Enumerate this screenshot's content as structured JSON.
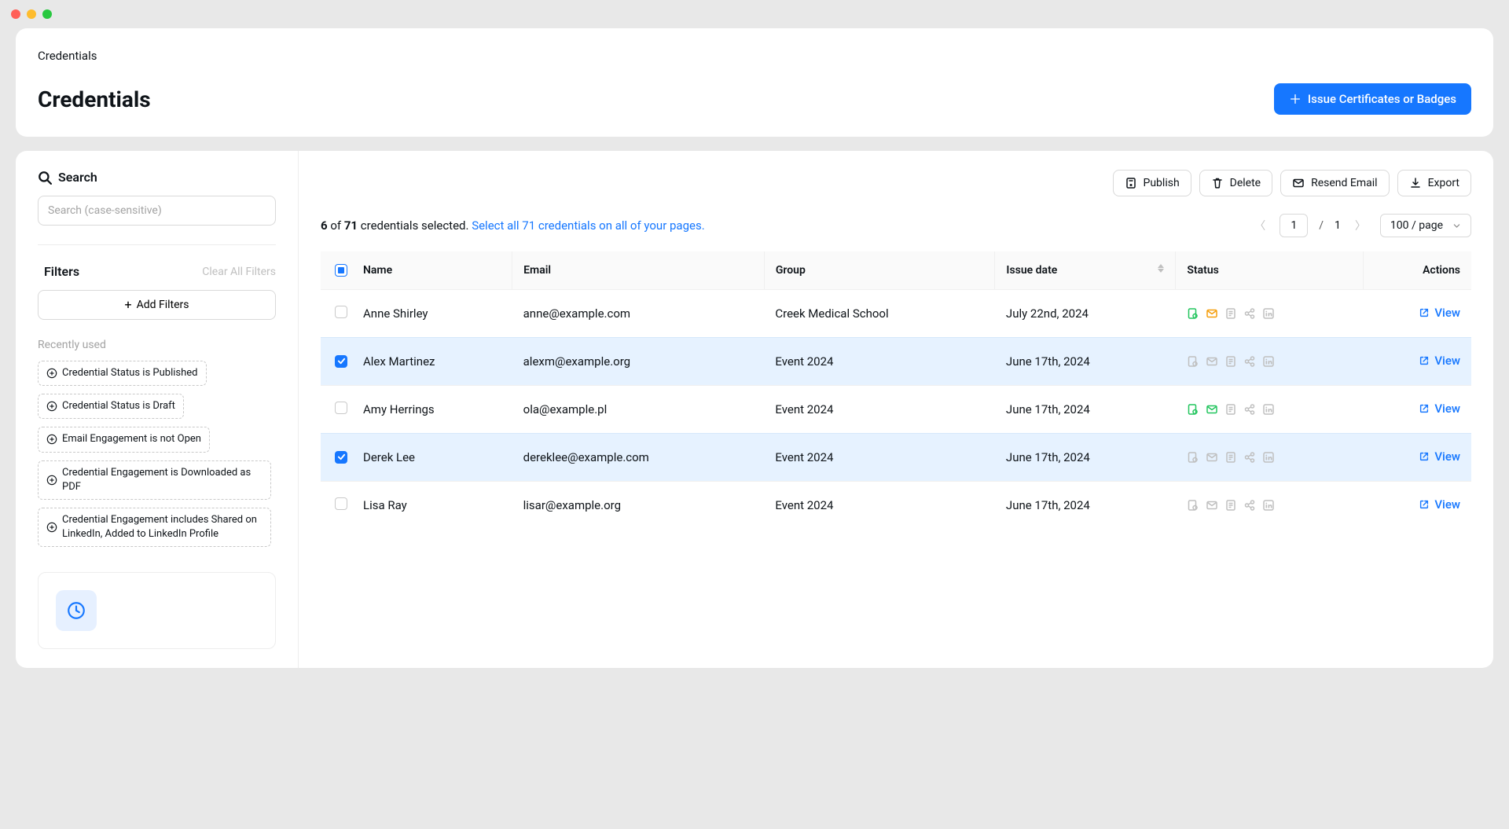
{
  "breadcrumb": "Credentials",
  "pageTitle": "Credentials",
  "issueButton": "Issue Certificates or Badges",
  "search": {
    "heading": "Search",
    "placeholder": "Search (case-sensitive)"
  },
  "filters": {
    "heading": "Filters",
    "clearAll": "Clear All Filters",
    "addFilters": "Add Filters",
    "recentlyUsed": "Recently used",
    "chips": [
      "Credential Status is Published",
      "Credential Status is Draft",
      "Email Engagement is not Open",
      "Credential Engagement is Downloaded as PDF",
      "Credential Engagement includes Shared on LinkedIn, Added to LinkedIn Profile"
    ]
  },
  "toolbar": {
    "publish": "Publish",
    "delete": "Delete",
    "resend": "Resend Email",
    "export": "Export"
  },
  "selection": {
    "countSelected": "6",
    "of": " of ",
    "total": "71",
    "suffix": " credentials selected. ",
    "selectAll": "Select all 71 credentials on all of your pages."
  },
  "pager": {
    "current": "1",
    "totalPages": "1",
    "perPage": "100 / page"
  },
  "columns": {
    "name": "Name",
    "email": "Email",
    "group": "Group",
    "issueDate": "Issue date",
    "status": "Status",
    "actions": "Actions"
  },
  "viewLabel": "View",
  "rows": [
    {
      "selected": false,
      "name": "Anne Shirley",
      "email": "anne@example.com",
      "group": "Creek Medical School",
      "issueDate": "July 22nd, 2024",
      "status": {
        "cert": "green",
        "mail": "orange",
        "doc": "gray",
        "share": "gray",
        "linkedin": "gray"
      }
    },
    {
      "selected": true,
      "name": "Alex Martinez",
      "email": "alexm@example.org",
      "group": "Event 2024",
      "issueDate": "June 17th, 2024",
      "status": {
        "cert": "gray",
        "mail": "gray",
        "doc": "gray",
        "share": "gray",
        "linkedin": "gray"
      }
    },
    {
      "selected": false,
      "name": "Amy Herrings",
      "email": "ola@example.pl",
      "group": "Event 2024",
      "issueDate": "June 17th, 2024",
      "status": {
        "cert": "green",
        "mail": "green",
        "doc": "gray",
        "share": "gray",
        "linkedin": "gray"
      }
    },
    {
      "selected": true,
      "name": "Derek Lee",
      "email": "dereklee@example.com",
      "group": "Event 2024",
      "issueDate": "June 17th, 2024",
      "status": {
        "cert": "gray",
        "mail": "gray",
        "doc": "gray",
        "share": "gray",
        "linkedin": "gray"
      }
    },
    {
      "selected": false,
      "name": "Lisa Ray",
      "email": "lisar@example.org",
      "group": "Event 2024",
      "issueDate": "June 17th, 2024",
      "status": {
        "cert": "gray",
        "mail": "gray",
        "doc": "gray",
        "share": "gray",
        "linkedin": "gray"
      }
    }
  ]
}
